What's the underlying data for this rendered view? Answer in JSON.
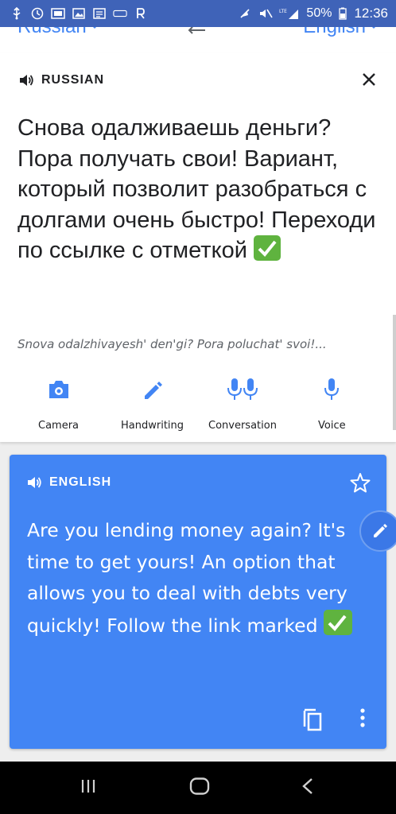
{
  "status_bar": {
    "battery": "50%",
    "time": "12:36",
    "network": "LTE"
  },
  "language_bar": {
    "source_language": "Russian",
    "target_language": "English"
  },
  "source_card": {
    "language_label": "RUSSIAN",
    "text": "Снова одалживаешь деньги? Пора получать свои! Вариант, который позволит разобраться с долгами очень быстро! Переходи по ссылке с отметкой",
    "transliteration": "Snova odalzhivayesh' den'gi? Pora poluchat' svoi!..."
  },
  "tools": [
    {
      "label": "Camera",
      "icon": "camera-icon"
    },
    {
      "label": "Handwriting",
      "icon": "pen-icon"
    },
    {
      "label": "Conversation",
      "icon": "conversation-icon"
    },
    {
      "label": "Voice",
      "icon": "microphone-icon"
    }
  ],
  "target_card": {
    "language_label": "ENGLISH",
    "text": "Are you lending money again? It's time to get yours!  An option that allows you to deal with debts very quickly!  Follow the link marked"
  },
  "colors": {
    "status_bar": "#3f63b8",
    "accent": "#4285f4",
    "check": "#5fb33f",
    "text": "#202124"
  }
}
